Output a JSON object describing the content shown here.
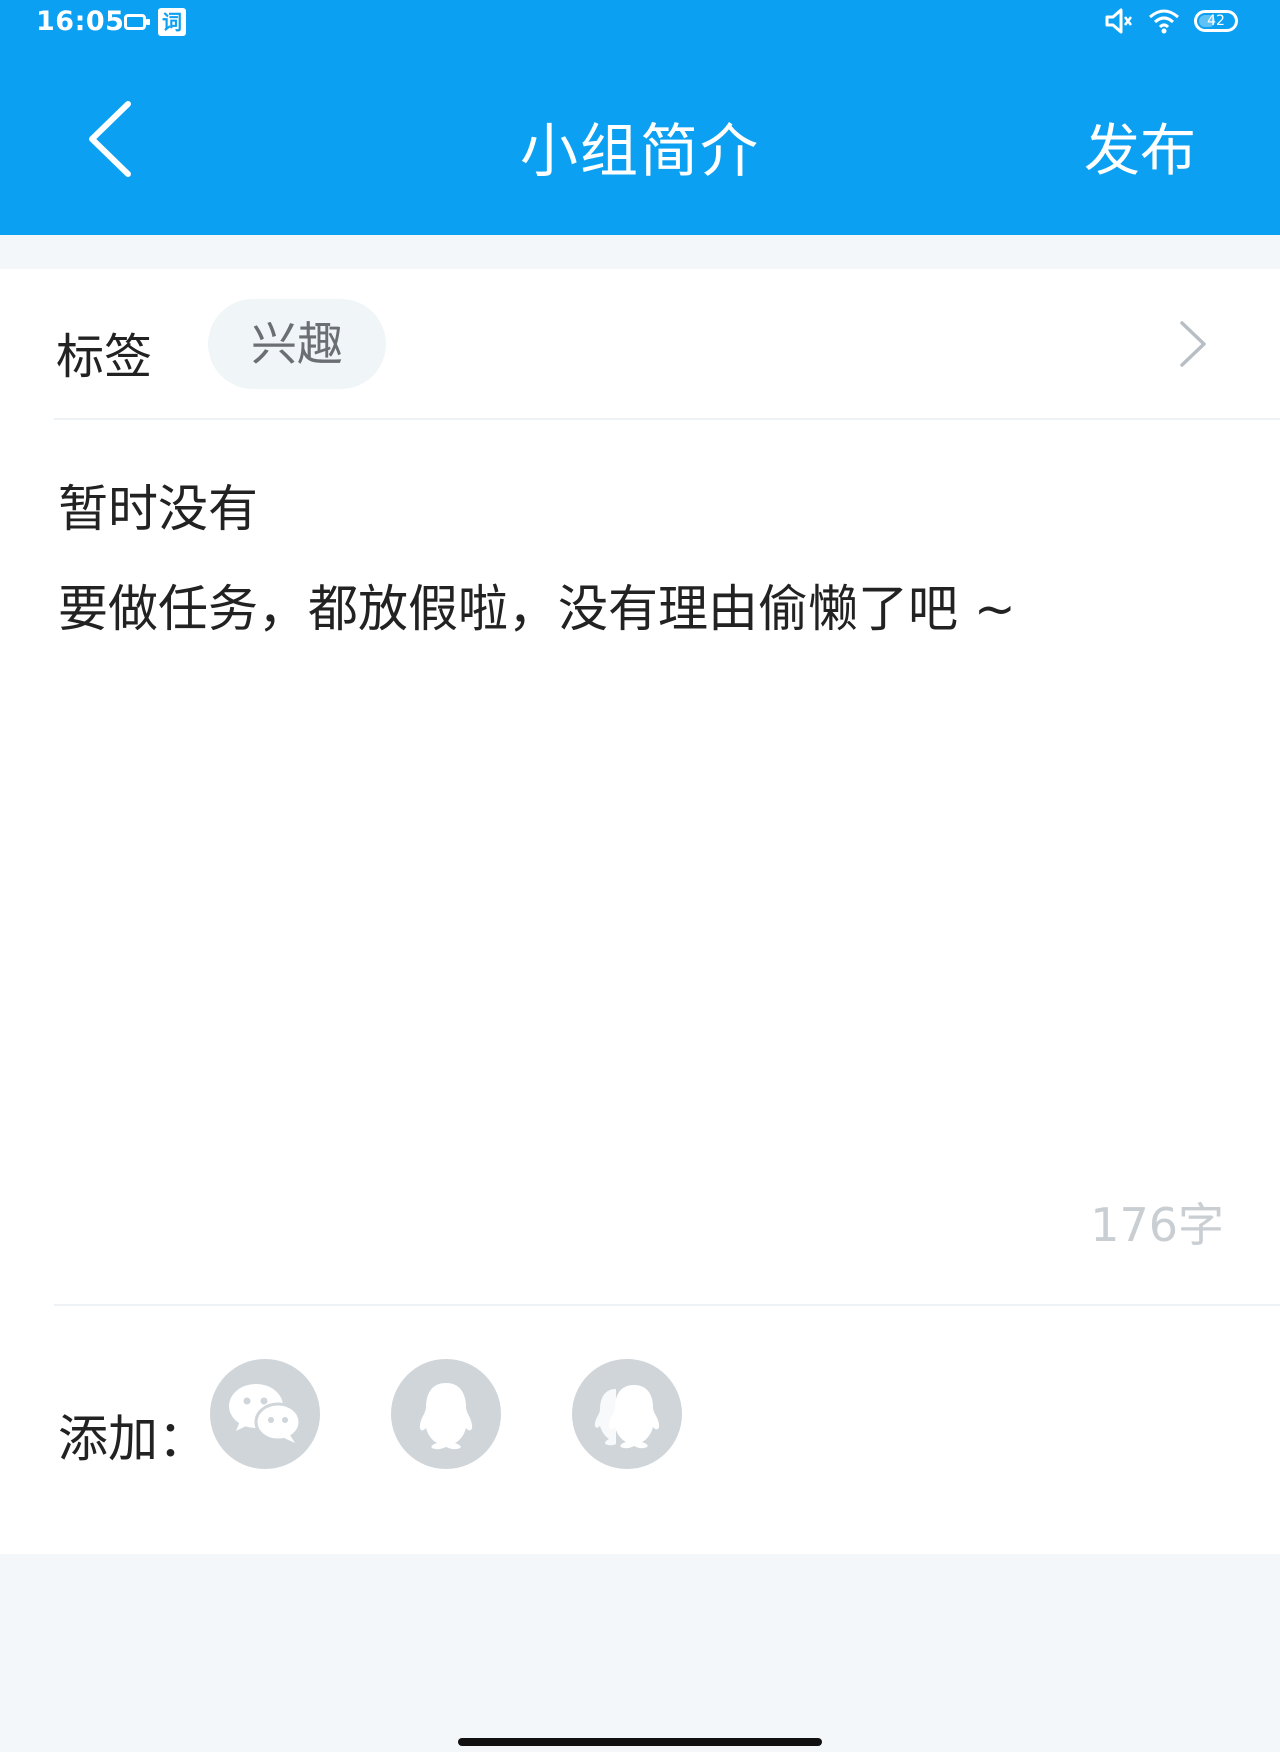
{
  "status_bar": {
    "time": "16:05",
    "app_icon_text": "词",
    "battery": "42"
  },
  "nav": {
    "title": "小组简介",
    "publish_label": "发布"
  },
  "tag": {
    "label": "标签",
    "chip": "兴趣"
  },
  "description": {
    "line1": "暂时没有",
    "line2": "要做任务，都放假啦，没有理由偷懒了吧 ~"
  },
  "char_count": "176字",
  "add": {
    "label": "添加：",
    "options": [
      "wechat-icon",
      "qq-icon",
      "qq-group-icon"
    ]
  },
  "colors": {
    "header_bg": "#0ca0f2",
    "page_bg": "#f3f7fa",
    "icon_gray": "#cfd5d9"
  }
}
